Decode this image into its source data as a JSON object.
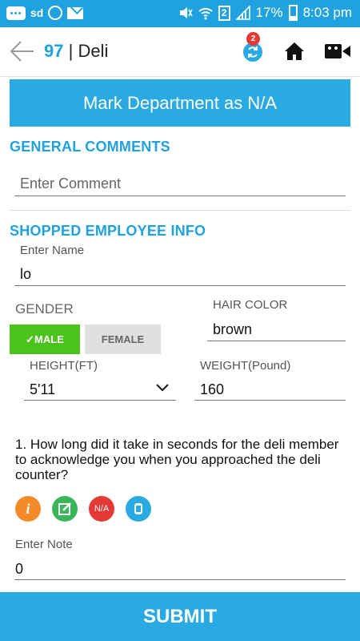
{
  "status_bar": {
    "sd_label": "sd",
    "sim_label": "2",
    "battery": "17%",
    "time": "8:03 pm"
  },
  "app_bar": {
    "number": "97",
    "separator": " | ",
    "title": "Deli",
    "sync_badge": "2"
  },
  "mark_button": "Mark Department as N/A",
  "general_comments": {
    "heading": "GENERAL COMMENTS",
    "comment_placeholder": "Enter Comment"
  },
  "employee_info": {
    "heading": "SHOPPED EMPLOYEE INFO",
    "name_label": "Enter Name",
    "name_value": "lo",
    "gender_label": "GENDER",
    "male_label": "MALE",
    "female_label": "FEMALE",
    "selected_gender": "MALE",
    "hair_label": "HAIR COLOR",
    "hair_value": "brown",
    "height_label": "HEIGHT(FT)",
    "height_value": "5'11",
    "weight_label": "WEIGHT(Pound)",
    "weight_value": "160"
  },
  "question": {
    "text": "1. How long did it take in seconds for the deli member to acknowledge you when you approached the deli counter?",
    "na_label": "N/A",
    "note_label": "Enter Note",
    "note_value": "0"
  },
  "submit_label": "SUBMIT",
  "colors": {
    "accent": "#1fa2de",
    "male_selected": "#4cc21c",
    "info": "#f48a2a",
    "edit": "#3ab55a",
    "na": "#e53935"
  },
  "icons": [
    "back-arrow-icon",
    "sync-icon",
    "home-icon",
    "video-camera-icon",
    "chevron-down-icon",
    "info-icon",
    "edit-icon",
    "camera-roll-icon"
  ]
}
